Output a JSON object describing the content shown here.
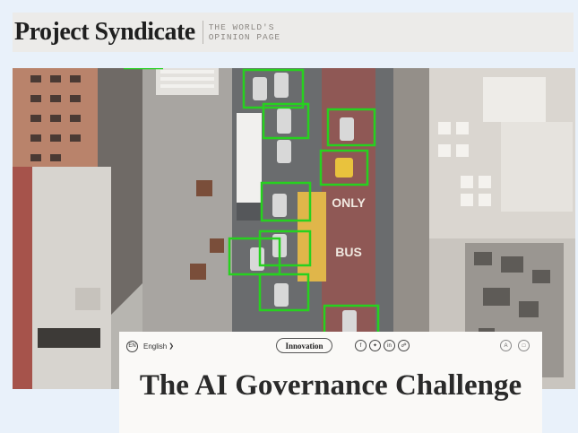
{
  "masthead": {
    "logo": "Project Syndicate",
    "tagline_line1": "THE WORLD'S",
    "tagline_line2": "OPINION PAGE"
  },
  "hero": {
    "road_markings": [
      "ONLY",
      "BUS"
    ],
    "detection_box_color": "#27d11f"
  },
  "article": {
    "language_code": "EN",
    "language": "English",
    "category": "Innovation",
    "share_icons": [
      "facebook-icon",
      "twitter-icon",
      "linkedin-icon",
      "link-icon"
    ],
    "right_icons": [
      "font-size-icon",
      "bookmark-icon"
    ],
    "headline": "The AI Governance Challenge"
  }
}
